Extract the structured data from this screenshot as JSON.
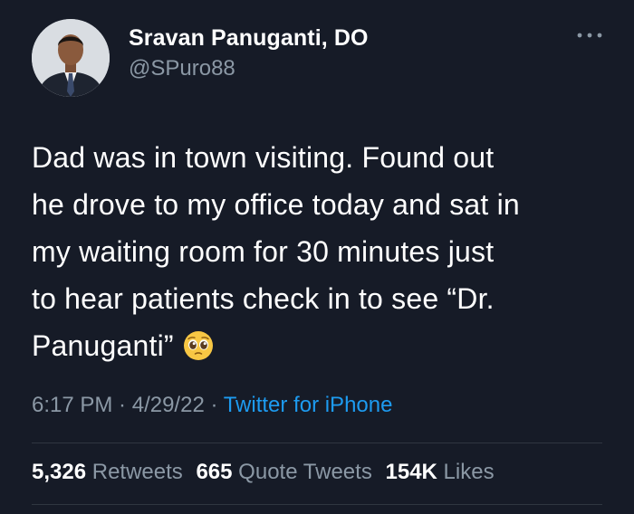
{
  "author": {
    "name": "Sravan Panuganti, DO",
    "handle": "@SPuro88"
  },
  "tweet": {
    "lines": [
      "Dad was in town visiting. Found out",
      "he drove to my office today and sat in",
      "my waiting room for 30 minutes just",
      "to hear patients check in to see “Dr.",
      "Panuganti”"
    ],
    "emoji": "pleading-face-emoji"
  },
  "meta": {
    "time": "6:17 PM",
    "sep1": " · ",
    "date": "4/29/22",
    "sep2": " · ",
    "source": "Twitter for iPhone"
  },
  "stats": {
    "retweets_count": "5,326",
    "retweets_label": "Retweets",
    "quotes_count": "665",
    "quotes_label": "Quote Tweets",
    "likes_count": "154K",
    "likes_label": "Likes"
  },
  "colors": {
    "background": "#161b27",
    "text": "#ffffff",
    "secondary": "#8b98a5",
    "link": "#1d9bf0"
  },
  "icons": {
    "more": "more-horizontal-icon",
    "avatar": "profile-photo"
  }
}
